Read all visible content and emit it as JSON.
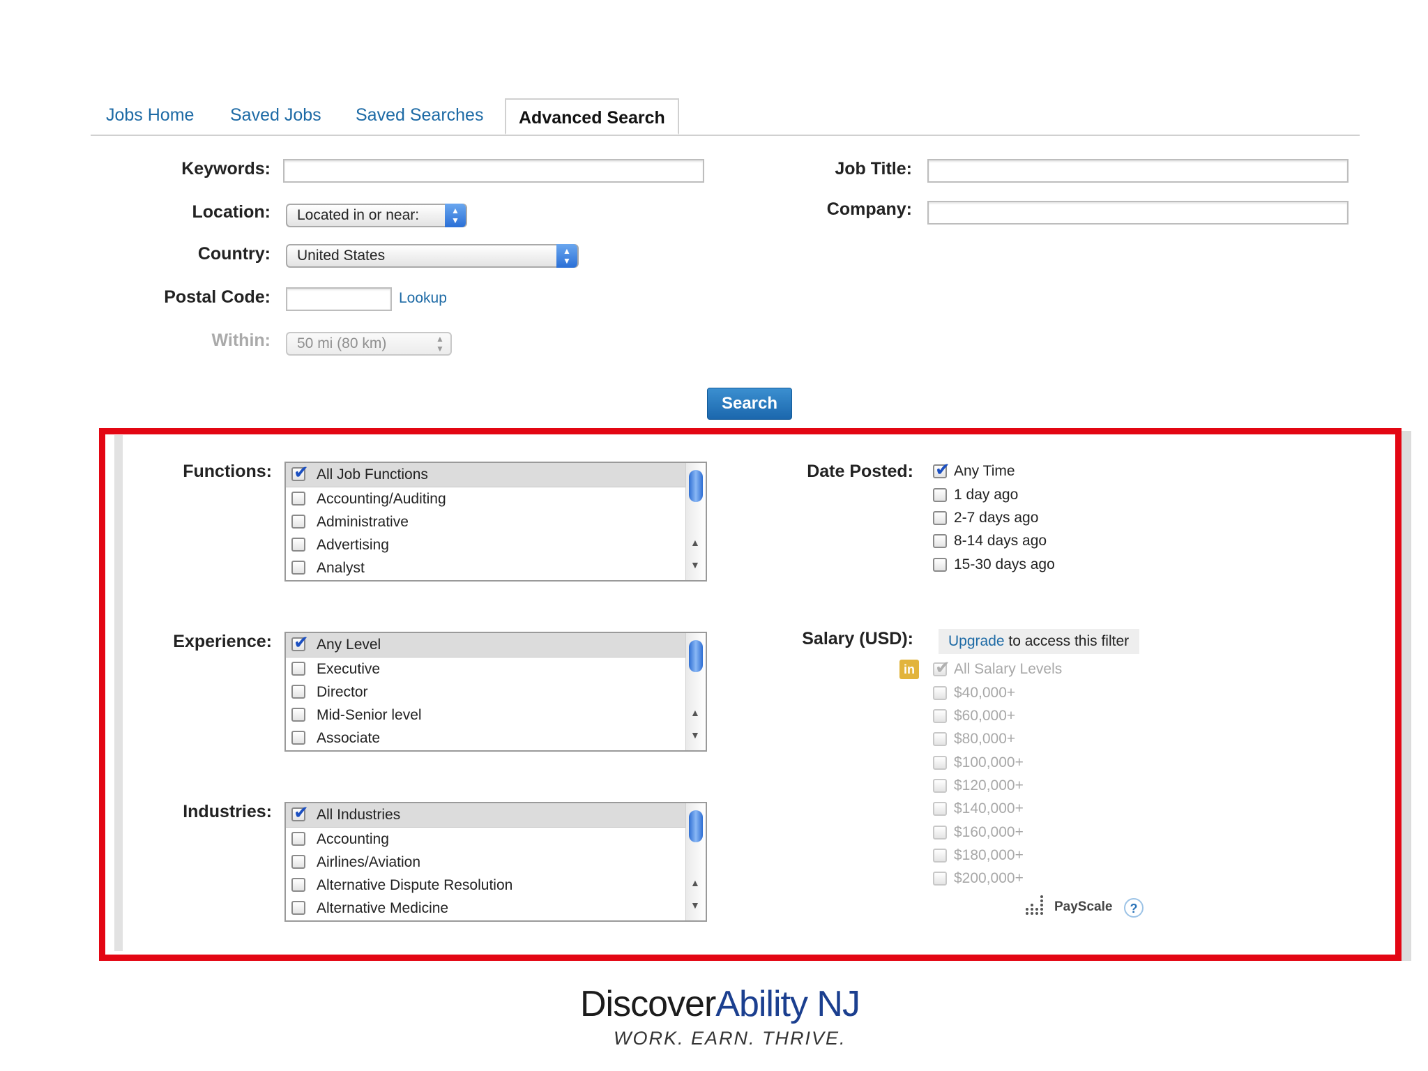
{
  "tabs": [
    "Jobs Home",
    "Saved Jobs",
    "Saved Searches",
    "Advanced Search"
  ],
  "form": {
    "keywords_label": "Keywords:",
    "keywords_value": "",
    "job_title_label": "Job Title:",
    "job_title_value": "",
    "location_label": "Location:",
    "location_value": "Located in or near:",
    "company_label": "Company:",
    "company_value": "",
    "country_label": "Country:",
    "country_value": "United States",
    "postal_label": "Postal Code:",
    "postal_value": "",
    "lookup_label": "Lookup",
    "within_label": "Within:",
    "within_value": "50 mi (80 km)",
    "search_label": "Search"
  },
  "functions": {
    "label": "Functions:",
    "items": [
      "All Job Functions",
      "Accounting/Auditing",
      "Administrative",
      "Advertising",
      "Analyst"
    ],
    "checked": [
      true,
      false,
      false,
      false,
      false
    ]
  },
  "experience": {
    "label": "Experience:",
    "items": [
      "Any Level",
      "Executive",
      "Director",
      "Mid-Senior level",
      "Associate"
    ],
    "checked": [
      true,
      false,
      false,
      false,
      false
    ]
  },
  "industries": {
    "label": "Industries:",
    "items": [
      "All Industries",
      "Accounting",
      "Airlines/Aviation",
      "Alternative Dispute Resolution",
      "Alternative Medicine"
    ],
    "checked": [
      true,
      false,
      false,
      false,
      false
    ]
  },
  "date_posted": {
    "label": "Date Posted:",
    "items": [
      "Any Time",
      "1 day ago",
      "2-7 days ago",
      "8-14 days ago",
      "15-30 days ago"
    ],
    "checked": [
      true,
      false,
      false,
      false,
      false
    ]
  },
  "salary": {
    "label": "Salary (USD):",
    "upgrade_link": "Upgrade",
    "upgrade_text": " to access this filter",
    "linkedin_badge": "in",
    "items": [
      "All Salary Levels",
      "$40,000+",
      "$60,000+",
      "$80,000+",
      "$100,000+",
      "$120,000+",
      "$140,000+",
      "$160,000+",
      "$180,000+",
      "$200,000+"
    ],
    "checked": [
      true,
      false,
      false,
      false,
      false,
      false,
      false,
      false,
      false,
      false
    ],
    "payscale": "PayScale",
    "help": "?"
  },
  "footer": {
    "logo_part1": "Discover",
    "logo_part2": "Ability NJ",
    "tagline": "WORK. EARN. THRIVE."
  },
  "colors": {
    "link_blue": "#1d6aa5",
    "highlight_red": "#e30613",
    "button_blue": "#1b67ad"
  },
  "icons": {
    "checkbox": "checkmark-icon",
    "scroll_up": "up-arrow-icon",
    "scroll_down": "down-arrow-icon"
  }
}
